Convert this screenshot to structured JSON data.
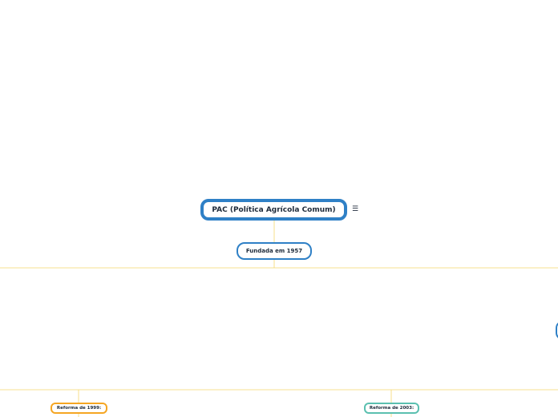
{
  "root": {
    "label": "PAC (Política Agrícola Comum)",
    "notes_icon": "notes-icon"
  },
  "level1": {
    "label": "Fundada em 1957"
  },
  "reforms": [
    {
      "label": "Reforma de 1999:",
      "color": "#f5a623"
    },
    {
      "label": "Reforma de 2003:",
      "color": "#5bc0b0"
    }
  ],
  "colors": {
    "node_border": "#2f80c6",
    "connector": "#f5d76e"
  }
}
